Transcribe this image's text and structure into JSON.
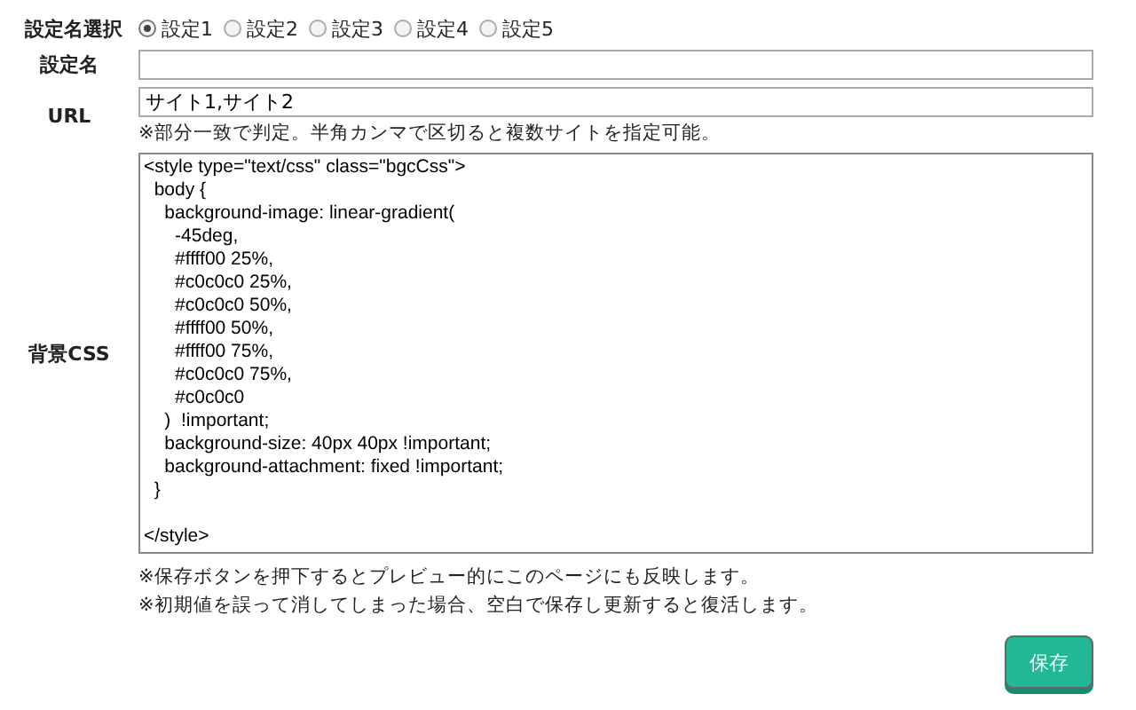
{
  "profile_select": {
    "label": "設定名選択",
    "options": [
      {
        "label": "設定1",
        "selected": true
      },
      {
        "label": "設定2",
        "selected": false
      },
      {
        "label": "設定3",
        "selected": false
      },
      {
        "label": "設定4",
        "selected": false
      },
      {
        "label": "設定5",
        "selected": false
      }
    ]
  },
  "name_field": {
    "label": "設定名"
  },
  "url_field": {
    "label": "URL",
    "value": "サイト1,サイト2",
    "note": "※部分一致で判定。半角カンマで区切ると複数サイトを指定可能。"
  },
  "css_field": {
    "label": "背景CSS",
    "value": "<style type=\"text/css\" class=\"bgcCss\">\n  body {\n    background-image: linear-gradient(\n      -45deg,\n      #ffff00 25%,\n      #c0c0c0 25%,\n      #c0c0c0 50%,\n      #ffff00 50%,\n      #ffff00 75%,\n      #c0c0c0 75%,\n      #c0c0c0\n    )  !important;\n    background-size: 40px 40px !important;\n    background-attachment: fixed !important;\n  }\n\n</style>"
  },
  "notes": [
    "※保存ボタンを押下するとプレビュー的にこのページにも反映します。",
    "※初期値を誤って消してしまった場合、空白で保存し更新すると復活します。"
  ],
  "save_button": {
    "label": "保存"
  }
}
